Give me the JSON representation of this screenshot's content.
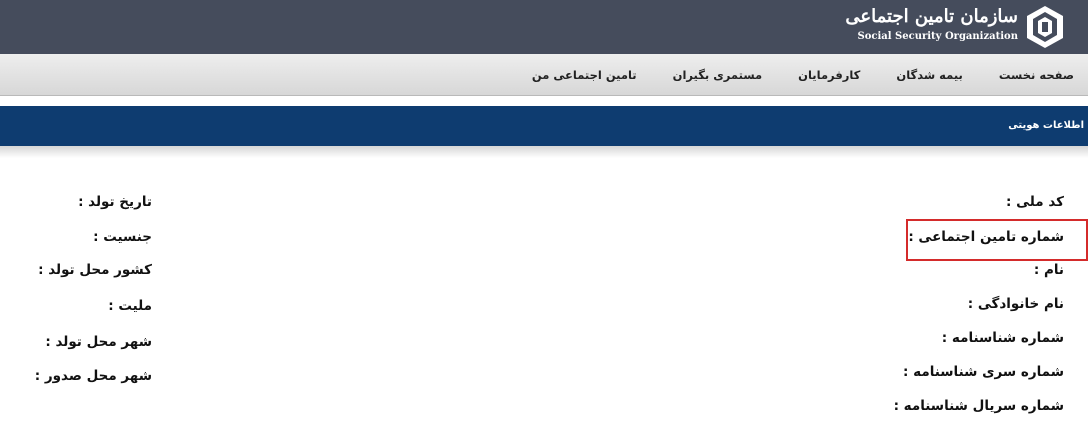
{
  "header": {
    "org_name_fa": "سازمان تامین اجتماعی",
    "org_name_en": "Social Security Organization",
    "logo_icon": "ssa-logo-icon"
  },
  "nav": {
    "items": [
      "صفحه نخست",
      "بیمه شدگان",
      "کارفرمایان",
      "مستمری بگیران",
      "تامین اجتماعی من"
    ]
  },
  "band": {
    "title": "اطلاعات هویتی"
  },
  "fields": {
    "right": [
      "کد ملی :",
      "شماره تامین اجتماعی :",
      "نام :",
      "نام خانوادگی :",
      "شماره شناسنامه :",
      "شماره سری شناسنامه :",
      "شماره سریال شناسنامه :"
    ],
    "left": [
      "تاریخ تولد :",
      "جنسیت :",
      "کشور محل تولد :",
      "ملیت :",
      "شهر محل تولد :",
      "شهر محل صدور :"
    ]
  },
  "colors": {
    "header_bg": "#454c5c",
    "band_bg": "#0e3c70",
    "highlight": "#d42b2b"
  }
}
